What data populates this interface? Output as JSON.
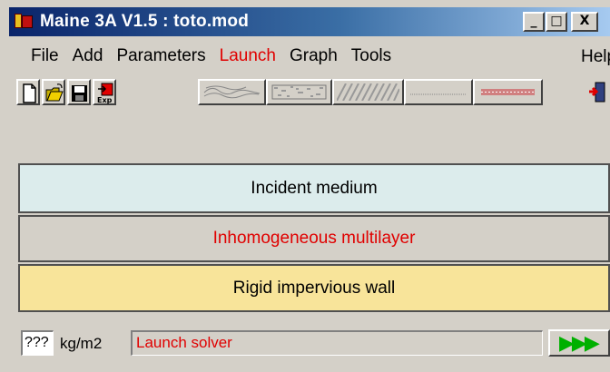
{
  "window": {
    "title": "Maine 3A V1.5 : toto.mod"
  },
  "caption_buttons": {
    "minimize": "_",
    "maximize": "□",
    "close": "X"
  },
  "menu": {
    "items": [
      "File",
      "Add",
      "Parameters",
      "Launch",
      "Graph",
      "Tools"
    ],
    "help": "Help",
    "active": "Launch"
  },
  "toolbar": {
    "file_buttons": [
      "new-file-icon",
      "open-folder-icon",
      "save-disk-icon",
      "export-icon"
    ],
    "export_label": "Exp",
    "layer_buttons": [
      "fluid-layer",
      "porous-layer",
      "solid-layer",
      "screen-layer",
      "septum-layer"
    ],
    "exit_icon": "exit-door-icon"
  },
  "layers": {
    "incident": "Incident medium",
    "multilayer": "Inhomogeneous multilayer",
    "wall": "Rigid impervious wall"
  },
  "colors": {
    "incident_bg": "#dcecec",
    "multilayer_text": "#e00000",
    "wall_bg": "#f8e49a",
    "run_arrows": "#00b000"
  },
  "status": {
    "mass_value": "???",
    "mass_unit": "kg/m2",
    "message": "Launch solver",
    "run_label": "▶▶▶"
  }
}
